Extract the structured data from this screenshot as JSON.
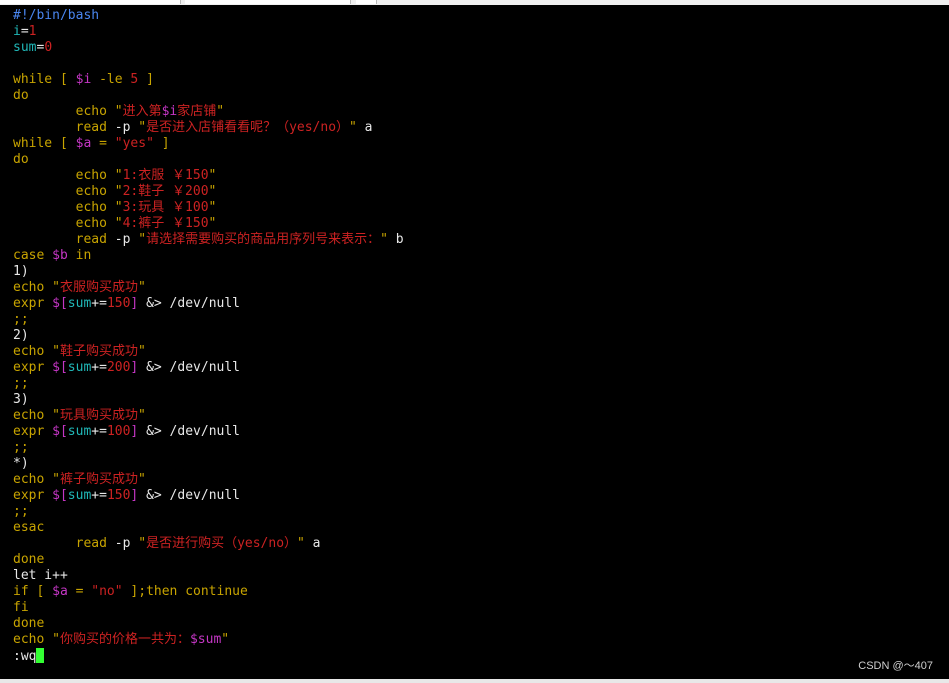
{
  "colors": {
    "background": "#000000",
    "plain": "#e8e8e8",
    "keyword": "#c8a400",
    "number": "#cc2222",
    "variable": "#c436c4",
    "string": "#cc2222",
    "identifier": "#20b8b8",
    "comment": "#4a86f0",
    "cursor": "#33ff33"
  },
  "editor": {
    "lines": [
      [
        {
          "t": "#!/bin/bash",
          "c": "comment"
        }
      ],
      [
        {
          "t": "i",
          "c": "identifier"
        },
        {
          "t": "=",
          "c": "plain"
        },
        {
          "t": "1",
          "c": "number"
        }
      ],
      [
        {
          "t": "sum",
          "c": "identifier"
        },
        {
          "t": "=",
          "c": "plain"
        },
        {
          "t": "0",
          "c": "number"
        }
      ],
      [],
      [
        {
          "t": "while",
          "c": "keyword"
        },
        {
          "t": " [ ",
          "c": "keyword"
        },
        {
          "t": "$i",
          "c": "variable"
        },
        {
          "t": " -le ",
          "c": "keyword"
        },
        {
          "t": "5",
          "c": "number"
        },
        {
          "t": " ]",
          "c": "keyword"
        }
      ],
      [
        {
          "t": "do",
          "c": "keyword"
        }
      ],
      [
        {
          "t": "        echo ",
          "c": "keyword"
        },
        {
          "t": "\"",
          "c": "keyword"
        },
        {
          "t": "进入第",
          "c": "string"
        },
        {
          "t": "$i",
          "c": "variable"
        },
        {
          "t": "家店铺",
          "c": "string"
        },
        {
          "t": "\"",
          "c": "keyword"
        }
      ],
      [
        {
          "t": "        read",
          "c": "keyword"
        },
        {
          "t": " -p ",
          "c": "plain"
        },
        {
          "t": "\"",
          "c": "keyword"
        },
        {
          "t": "是否进入店铺看看呢？（yes/no）",
          "c": "string"
        },
        {
          "t": "\"",
          "c": "keyword"
        },
        {
          "t": " a",
          "c": "plain"
        }
      ],
      [
        {
          "t": "while",
          "c": "keyword"
        },
        {
          "t": " [ ",
          "c": "keyword"
        },
        {
          "t": "$a",
          "c": "variable"
        },
        {
          "t": " = ",
          "c": "keyword"
        },
        {
          "t": "\"yes\"",
          "c": "string"
        },
        {
          "t": " ]",
          "c": "keyword"
        }
      ],
      [
        {
          "t": "do",
          "c": "keyword"
        }
      ],
      [
        {
          "t": "        echo ",
          "c": "keyword"
        },
        {
          "t": "\"",
          "c": "keyword"
        },
        {
          "t": "1:衣服 ￥150",
          "c": "string"
        },
        {
          "t": "\"",
          "c": "keyword"
        }
      ],
      [
        {
          "t": "        echo ",
          "c": "keyword"
        },
        {
          "t": "\"",
          "c": "keyword"
        },
        {
          "t": "2:鞋子 ￥200",
          "c": "string"
        },
        {
          "t": "\"",
          "c": "keyword"
        }
      ],
      [
        {
          "t": "        echo ",
          "c": "keyword"
        },
        {
          "t": "\"",
          "c": "keyword"
        },
        {
          "t": "3:玩具 ￥100",
          "c": "string"
        },
        {
          "t": "\"",
          "c": "keyword"
        }
      ],
      [
        {
          "t": "        echo ",
          "c": "keyword"
        },
        {
          "t": "\"",
          "c": "keyword"
        },
        {
          "t": "4:裤子 ￥150",
          "c": "string"
        },
        {
          "t": "\"",
          "c": "keyword"
        }
      ],
      [
        {
          "t": "        read",
          "c": "keyword"
        },
        {
          "t": " -p ",
          "c": "plain"
        },
        {
          "t": "\"",
          "c": "keyword"
        },
        {
          "t": "请选择需要购买的商品用序列号来表示：",
          "c": "string"
        },
        {
          "t": "\"",
          "c": "keyword"
        },
        {
          "t": " b",
          "c": "plain"
        }
      ],
      [
        {
          "t": "case",
          "c": "keyword"
        },
        {
          "t": " ",
          "c": "plain"
        },
        {
          "t": "$b",
          "c": "variable"
        },
        {
          "t": " in",
          "c": "keyword"
        }
      ],
      [
        {
          "t": "1)",
          "c": "plain"
        }
      ],
      [
        {
          "t": "echo ",
          "c": "keyword"
        },
        {
          "t": "\"",
          "c": "keyword"
        },
        {
          "t": "衣服购买成功",
          "c": "string"
        },
        {
          "t": "\"",
          "c": "keyword"
        }
      ],
      [
        {
          "t": "expr",
          "c": "keyword"
        },
        {
          "t": " ",
          "c": "plain"
        },
        {
          "t": "$[",
          "c": "variable"
        },
        {
          "t": "sum",
          "c": "identifier"
        },
        {
          "t": "+=",
          "c": "plain"
        },
        {
          "t": "150",
          "c": "number"
        },
        {
          "t": "]",
          "c": "variable"
        },
        {
          "t": " &> /dev/null",
          "c": "plain"
        }
      ],
      [
        {
          "t": ";;",
          "c": "keyword"
        }
      ],
      [
        {
          "t": "2)",
          "c": "plain"
        }
      ],
      [
        {
          "t": "echo ",
          "c": "keyword"
        },
        {
          "t": "\"",
          "c": "keyword"
        },
        {
          "t": "鞋子购买成功",
          "c": "string"
        },
        {
          "t": "\"",
          "c": "keyword"
        }
      ],
      [
        {
          "t": "expr",
          "c": "keyword"
        },
        {
          "t": " ",
          "c": "plain"
        },
        {
          "t": "$[",
          "c": "variable"
        },
        {
          "t": "sum",
          "c": "identifier"
        },
        {
          "t": "+=",
          "c": "plain"
        },
        {
          "t": "200",
          "c": "number"
        },
        {
          "t": "]",
          "c": "variable"
        },
        {
          "t": " &> /dev/null",
          "c": "plain"
        }
      ],
      [
        {
          "t": ";;",
          "c": "keyword"
        }
      ],
      [
        {
          "t": "3)",
          "c": "plain"
        }
      ],
      [
        {
          "t": "echo ",
          "c": "keyword"
        },
        {
          "t": "\"",
          "c": "keyword"
        },
        {
          "t": "玩具购买成功",
          "c": "string"
        },
        {
          "t": "\"",
          "c": "keyword"
        }
      ],
      [
        {
          "t": "expr",
          "c": "keyword"
        },
        {
          "t": " ",
          "c": "plain"
        },
        {
          "t": "$[",
          "c": "variable"
        },
        {
          "t": "sum",
          "c": "identifier"
        },
        {
          "t": "+=",
          "c": "plain"
        },
        {
          "t": "100",
          "c": "number"
        },
        {
          "t": "]",
          "c": "variable"
        },
        {
          "t": " &> /dev/null",
          "c": "plain"
        }
      ],
      [
        {
          "t": ";;",
          "c": "keyword"
        }
      ],
      [
        {
          "t": "*)",
          "c": "plain"
        }
      ],
      [
        {
          "t": "echo ",
          "c": "keyword"
        },
        {
          "t": "\"",
          "c": "keyword"
        },
        {
          "t": "裤子购买成功",
          "c": "string"
        },
        {
          "t": "\"",
          "c": "keyword"
        }
      ],
      [
        {
          "t": "expr",
          "c": "keyword"
        },
        {
          "t": " ",
          "c": "plain"
        },
        {
          "t": "$[",
          "c": "variable"
        },
        {
          "t": "sum",
          "c": "identifier"
        },
        {
          "t": "+=",
          "c": "plain"
        },
        {
          "t": "150",
          "c": "number"
        },
        {
          "t": "]",
          "c": "variable"
        },
        {
          "t": " &> /dev/null",
          "c": "plain"
        }
      ],
      [
        {
          "t": ";;",
          "c": "keyword"
        }
      ],
      [
        {
          "t": "esac",
          "c": "keyword"
        }
      ],
      [
        {
          "t": "        read",
          "c": "keyword"
        },
        {
          "t": " -p ",
          "c": "plain"
        },
        {
          "t": "\"",
          "c": "keyword"
        },
        {
          "t": "是否进行购买（yes/no）",
          "c": "string"
        },
        {
          "t": "\"",
          "c": "keyword"
        },
        {
          "t": " a",
          "c": "plain"
        }
      ],
      [
        {
          "t": "done",
          "c": "keyword"
        }
      ],
      [
        {
          "t": "let i++",
          "c": "plain"
        }
      ],
      [
        {
          "t": "if",
          "c": "keyword"
        },
        {
          "t": " [ ",
          "c": "keyword"
        },
        {
          "t": "$a",
          "c": "variable"
        },
        {
          "t": " = ",
          "c": "keyword"
        },
        {
          "t": "\"no\"",
          "c": "string"
        },
        {
          "t": " ];then continue",
          "c": "keyword"
        }
      ],
      [
        {
          "t": "fi",
          "c": "keyword"
        }
      ],
      [
        {
          "t": "done",
          "c": "keyword"
        }
      ],
      [
        {
          "t": "echo ",
          "c": "keyword"
        },
        {
          "t": "\"",
          "c": "keyword"
        },
        {
          "t": "你购买的价格一共为：",
          "c": "string"
        },
        {
          "t": "$sum",
          "c": "variable"
        },
        {
          "t": "\"",
          "c": "keyword"
        }
      ]
    ],
    "command_line": ":wq"
  },
  "watermark": "CSDN @～407"
}
